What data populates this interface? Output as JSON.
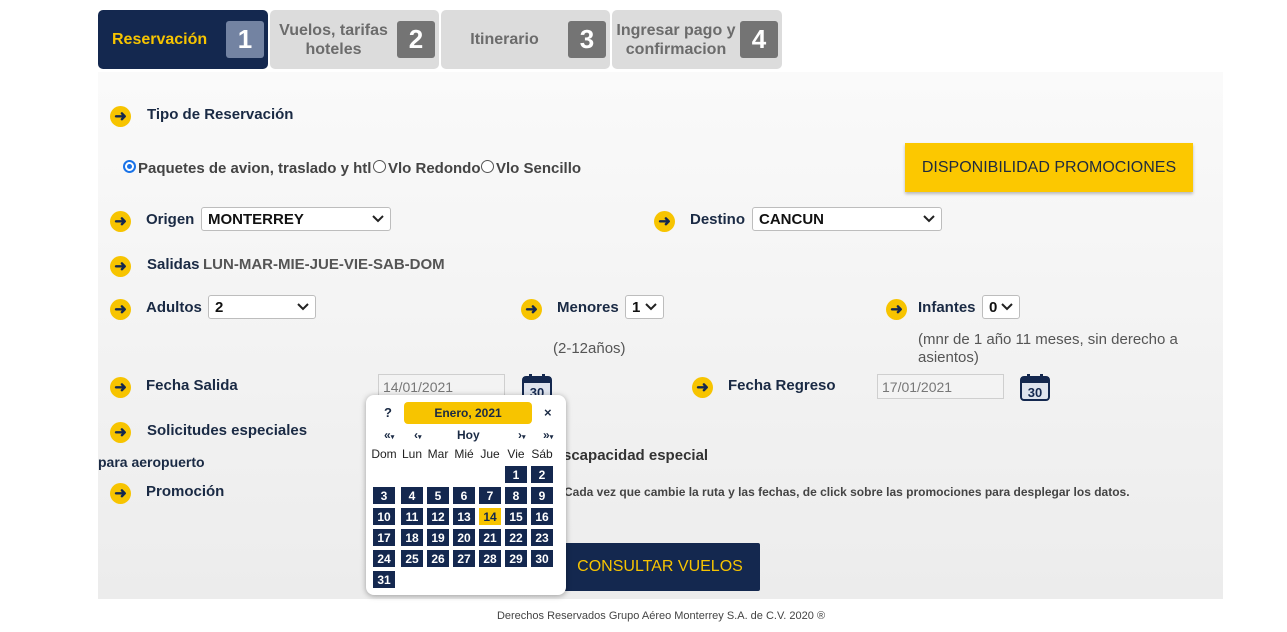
{
  "steps": [
    {
      "label": "Reservación",
      "num": "1"
    },
    {
      "label": "Vuelos, tarifas hoteles",
      "num": "2"
    },
    {
      "label": "Itinerario",
      "num": "3"
    },
    {
      "label": "Ingresar pago y confirmacion",
      "num": "4"
    }
  ],
  "form": {
    "tipo_label": "Tipo de Reservación",
    "radio_paquetes": "Paquetes de avion, traslado y htl",
    "radio_redondo": "Vlo Redondo",
    "radio_sencillo": "Vlo Sencillo",
    "promo_button": "DISPONIBILIDAD PROMOCIONES",
    "origen_label": "Origen",
    "origen_value": "MONTERREY",
    "destino_label": "Destino",
    "destino_value": "CANCUN",
    "salidas_label": "Salidas",
    "salidas_value": "LUN-MAR-MIE-JUE-VIE-SAB-DOM",
    "adultos_label": "Adultos",
    "adultos_value": "2",
    "menores_label": "Menores",
    "menores_value": "1",
    "menores_note": "(2-12años)",
    "infantes_label": "Infantes",
    "infantes_value": "0",
    "infantes_note": "(mnr de 1 año 11 meses, sin derecho a asientos)",
    "fecha_salida_label": "Fecha Salida",
    "fecha_salida_value": "14/01/2021",
    "fecha_regreso_label": "Fecha Regreso",
    "fecha_regreso_value": "17/01/2021",
    "solicitudes_label": "Solicitudes especiales",
    "para_aeropuerto": "para aeropuerto",
    "discapacidad": "scapacidad especial",
    "promocion_label": "Promoción",
    "promocion_note": "Cada vez que cambie la ruta y las fechas, de click sobre las promociones para desplegar los datos.",
    "consultar_button": "CONSULTAR VUELOS",
    "cal_icon_text": "30"
  },
  "calendar": {
    "help": "?",
    "title": "Enero, 2021",
    "close": "×",
    "nav_prev_year": "«",
    "nav_prev_month": "‹",
    "nav_today": "Hoy",
    "nav_next_month": "›",
    "nav_next_year": "»",
    "weekdays": [
      "Dom",
      "Lun",
      "Mar",
      "Mié",
      "Jue",
      "Vie",
      "Sáb"
    ],
    "first_weekday_index": 5,
    "days_in_month": 31,
    "selected_day": 14
  },
  "footer": "Derechos Reservados Grupo Aéreo Monterrey S.A. de C.V. 2020 ®",
  "colors": {
    "navy": "#14284f",
    "yellow": "#f7c400",
    "promo_yellow": "#fcc800"
  }
}
